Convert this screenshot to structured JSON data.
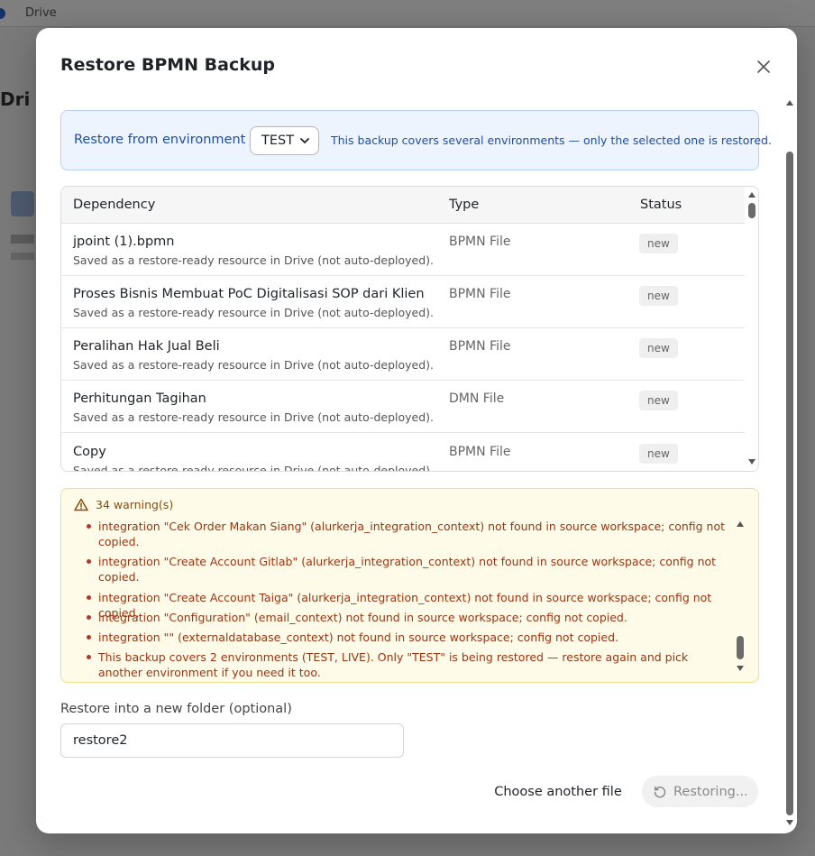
{
  "background": {
    "crumb": "Drive"
  },
  "modal": {
    "title": "Restore BPMN Backup",
    "close_icon": "close-icon"
  },
  "environment": {
    "label": "Restore from environment",
    "selected": "TEST",
    "note": "This backup covers several environments — only the selected one is restored."
  },
  "table": {
    "headers": [
      "Dependency",
      "Type",
      "Status"
    ],
    "rows": [
      {
        "name": "jpoint (1).bpmn",
        "desc": "Saved as a restore-ready resource in Drive (not auto-deployed).",
        "type": "BPMN File",
        "status": "new"
      },
      {
        "name": "Proses Bisnis Membuat PoC Digitalisasi SOP dari Klien",
        "desc": "Saved as a restore-ready resource in Drive (not auto-deployed).",
        "type": "BPMN File",
        "status": "new"
      },
      {
        "name": "Peralihan Hak Jual Beli",
        "desc": "Saved as a restore-ready resource in Drive (not auto-deployed).",
        "type": "BPMN File",
        "status": "new"
      },
      {
        "name": "Perhitungan Tagihan",
        "desc": "Saved as a restore-ready resource in Drive (not auto-deployed).",
        "type": "DMN File",
        "status": "new"
      },
      {
        "name": "Copy",
        "desc": "Saved as a restore-ready resource in Drive (not auto-deployed).",
        "type": "BPMN File",
        "status": "new"
      }
    ]
  },
  "warnings": {
    "title": "34 warning(s)",
    "items": [
      "integration \"Cek Order Makan Siang\" (alurkerja_integration_context) not found in source workspace; config not copied.",
      "integration \"Create Account Gitlab\" (alurkerja_integration_context) not found in source workspace; config not copied.",
      "integration \"Create Account Taiga\" (alurkerja_integration_context) not found in source workspace; config not copied.",
      "integration \"Configuration\" (email_context) not found in source workspace; config not copied.",
      "integration \"\" (externaldatabase_context) not found in source workspace; config not copied.",
      "This backup covers 2 environments (TEST, LIVE). Only \"TEST\" is being restored — restore again and pick another environment if you need it too."
    ]
  },
  "folder": {
    "label": "Restore into a new folder (optional)",
    "value": "restore2"
  },
  "footer": {
    "choose_label": "Choose another file",
    "restore_label": "Restoring..."
  },
  "colors": {
    "accent_blue": "#1d4ea3",
    "warning_text": "#9a3412",
    "warning_bg": "#fefbe8"
  }
}
